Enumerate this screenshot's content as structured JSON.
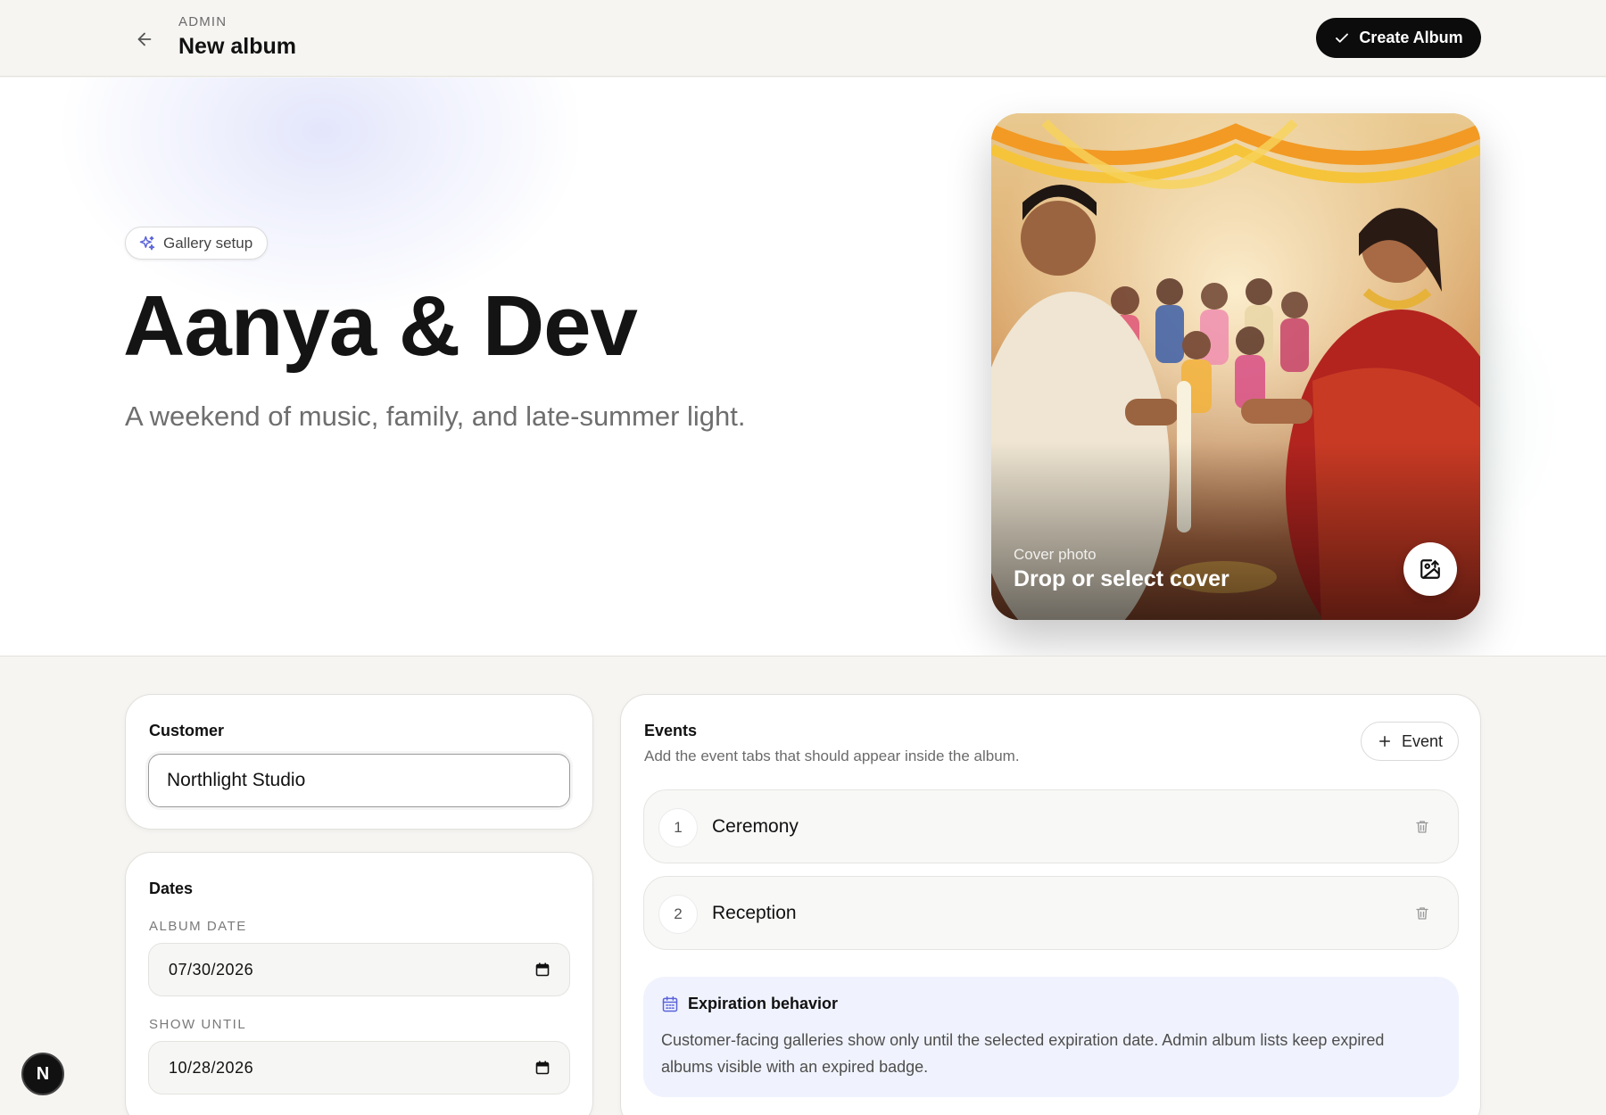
{
  "header": {
    "crumb": "ADMIN",
    "title": "New album",
    "create_label": "Create Album"
  },
  "hero": {
    "badge": "Gallery setup",
    "title": "Aanya & Dev",
    "subtitle": "A weekend of music, family, and late-summer light.",
    "cover": {
      "label": "Cover photo",
      "cta": "Drop or select cover"
    }
  },
  "customer": {
    "heading": "Customer",
    "value": "Northlight Studio"
  },
  "dates": {
    "heading": "Dates",
    "album_date_label": "ALBUM DATE",
    "album_date_value": "07/30/2026",
    "show_until_label": "SHOW UNTIL",
    "show_until_value": "10/28/2026"
  },
  "events": {
    "heading": "Events",
    "subtitle": "Add the event tabs that should appear inside the album.",
    "add_label": "Event",
    "items": [
      {
        "num": "1",
        "name": "Ceremony"
      },
      {
        "num": "2",
        "name": "Reception"
      }
    ],
    "expiration": {
      "heading": "Expiration behavior",
      "text": "Customer-facing galleries show only until the selected expiration date. Admin album lists keep expired albums visible with an expired badge."
    }
  },
  "dev_badge": "N",
  "colors": {
    "accent": "#5b63d9",
    "primary_button": "#0c0c0c",
    "info_bg": "#f0f3fd"
  },
  "icons": {
    "back": "arrow-left-icon",
    "check": "check-icon",
    "sparkle": "sparkles-icon",
    "cover_upload": "image-upload-icon",
    "calendar": "calendar-icon",
    "plus": "plus-icon",
    "trash": "trash-icon"
  }
}
